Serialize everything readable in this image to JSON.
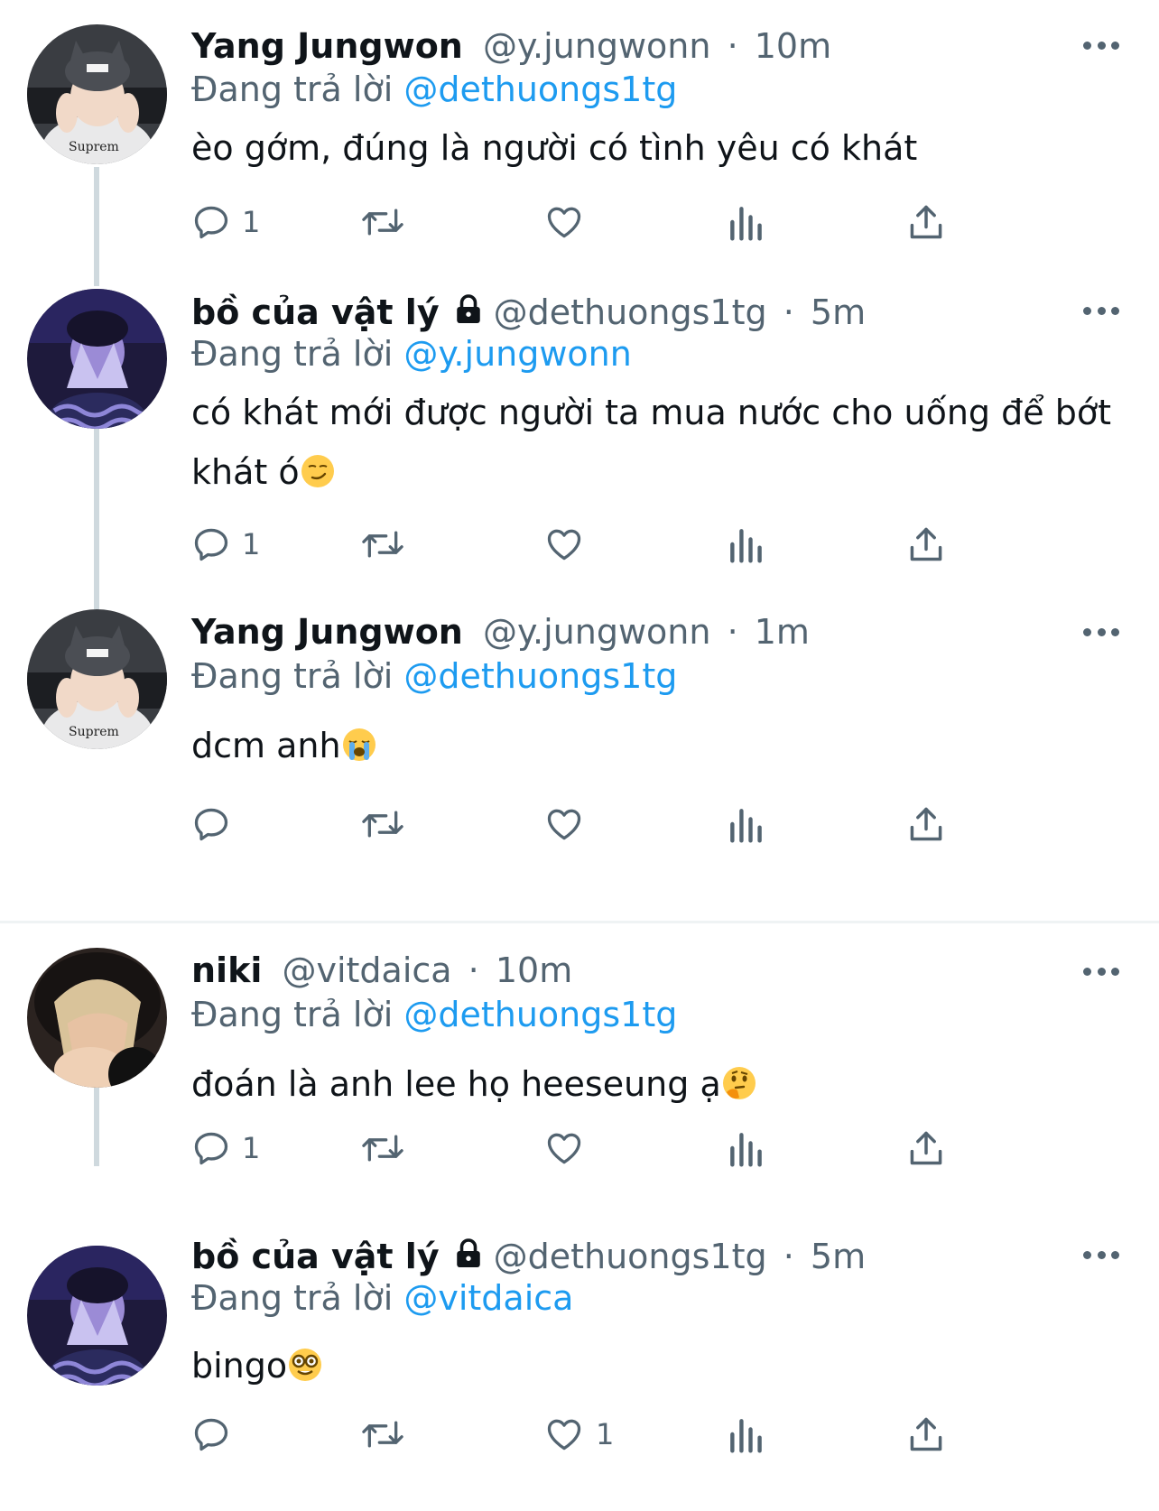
{
  "tweets": [
    {
      "name": "Yang Jungwon",
      "handle": "@y.jungwonn",
      "sep": "·",
      "time": "10m",
      "replying_prefix": "Đang trả lời ",
      "replying_to": "@dethuongs1tg",
      "text": "èo gớm, đúng là người có tình yêu có khát",
      "reply_count": "1",
      "like_count": "",
      "avatar": "avatar-photo"
    },
    {
      "name": "bồ của vật lý",
      "handle": "@dethuongs1tg",
      "sep": "·",
      "time": "5m",
      "replying_prefix": "Đang trả lời ",
      "replying_to": "@y.jungwonn",
      "text": "có khát mới được người ta mua nước cho uống để bớt khát ó",
      "emoji": "smirking-face-emoji",
      "reply_count": "1",
      "like_count": "",
      "locked": true
    },
    {
      "name": "Yang Jungwon",
      "handle": "@y.jungwonn",
      "sep": "·",
      "time": "1m",
      "replying_prefix": "Đang trả lời ",
      "replying_to": "@dethuongs1tg",
      "text": "dcm anh",
      "emoji": "loudly-crying-face-emoji",
      "reply_count": "",
      "like_count": ""
    },
    {
      "name": "niki",
      "handle": "@vitdaica",
      "sep": "·",
      "time": "10m",
      "replying_prefix": "Đang trả lời ",
      "replying_to": "@dethuongs1tg",
      "text": "đoán là anh lee họ heeseung ạ",
      "emoji": "thinking-face-emoji",
      "reply_count": "1",
      "like_count": ""
    },
    {
      "name": "bồ của vật lý",
      "handle": "@dethuongs1tg",
      "sep": "·",
      "time": "5m",
      "replying_prefix": "Đang trả lời ",
      "replying_to": "@vitdaica",
      "text": "bingo",
      "emoji": "nerd-face-emoji",
      "reply_count": "",
      "like_count": "1",
      "locked": true
    }
  ],
  "colors": {
    "text": "#0f1419",
    "secondary": "#536471",
    "link": "#1d9bf0",
    "thread_line": "#cfd9de",
    "divider": "#eff3f4"
  },
  "icons": [
    "reply-icon",
    "retweet-icon",
    "like-icon",
    "views-icon",
    "share-icon",
    "more-icon",
    "lock-icon"
  ]
}
